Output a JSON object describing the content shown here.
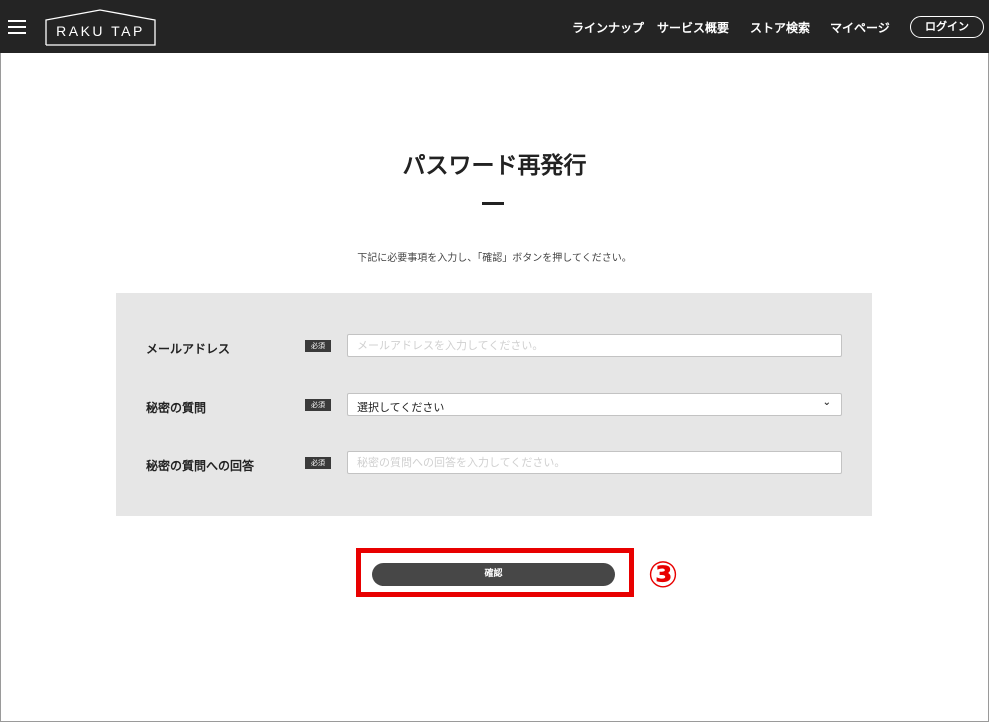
{
  "header": {
    "logo_text": "RAKU TAP",
    "nav": [
      "ラインナップ",
      "サービス概要",
      "ストア検索",
      "マイページ"
    ],
    "login_label": "ログイン"
  },
  "main": {
    "title": "パスワード再発行",
    "instruction": "下記に必要事項を入力し、「確認」ボタンを押してください。",
    "required_badge": "必須",
    "fields": [
      {
        "label": "メールアドレス",
        "placeholder": "メールアドレスを入力してください。",
        "value": ""
      },
      {
        "label": "秘密の質問",
        "selected": "選択してください"
      },
      {
        "label": "秘密の質問への回答",
        "placeholder": "秘密の質問への回答を入力してください。",
        "value": ""
      }
    ],
    "confirm_label": "確認",
    "step_marker": "③"
  },
  "colors": {
    "header_bg": "#242424",
    "panel_bg": "#e6e6e6",
    "button_bg": "#474747",
    "highlight": "#e80000"
  },
  "icons": [
    "hamburger-menu-icon",
    "house-logo-icon",
    "chevron-down-icon"
  ]
}
